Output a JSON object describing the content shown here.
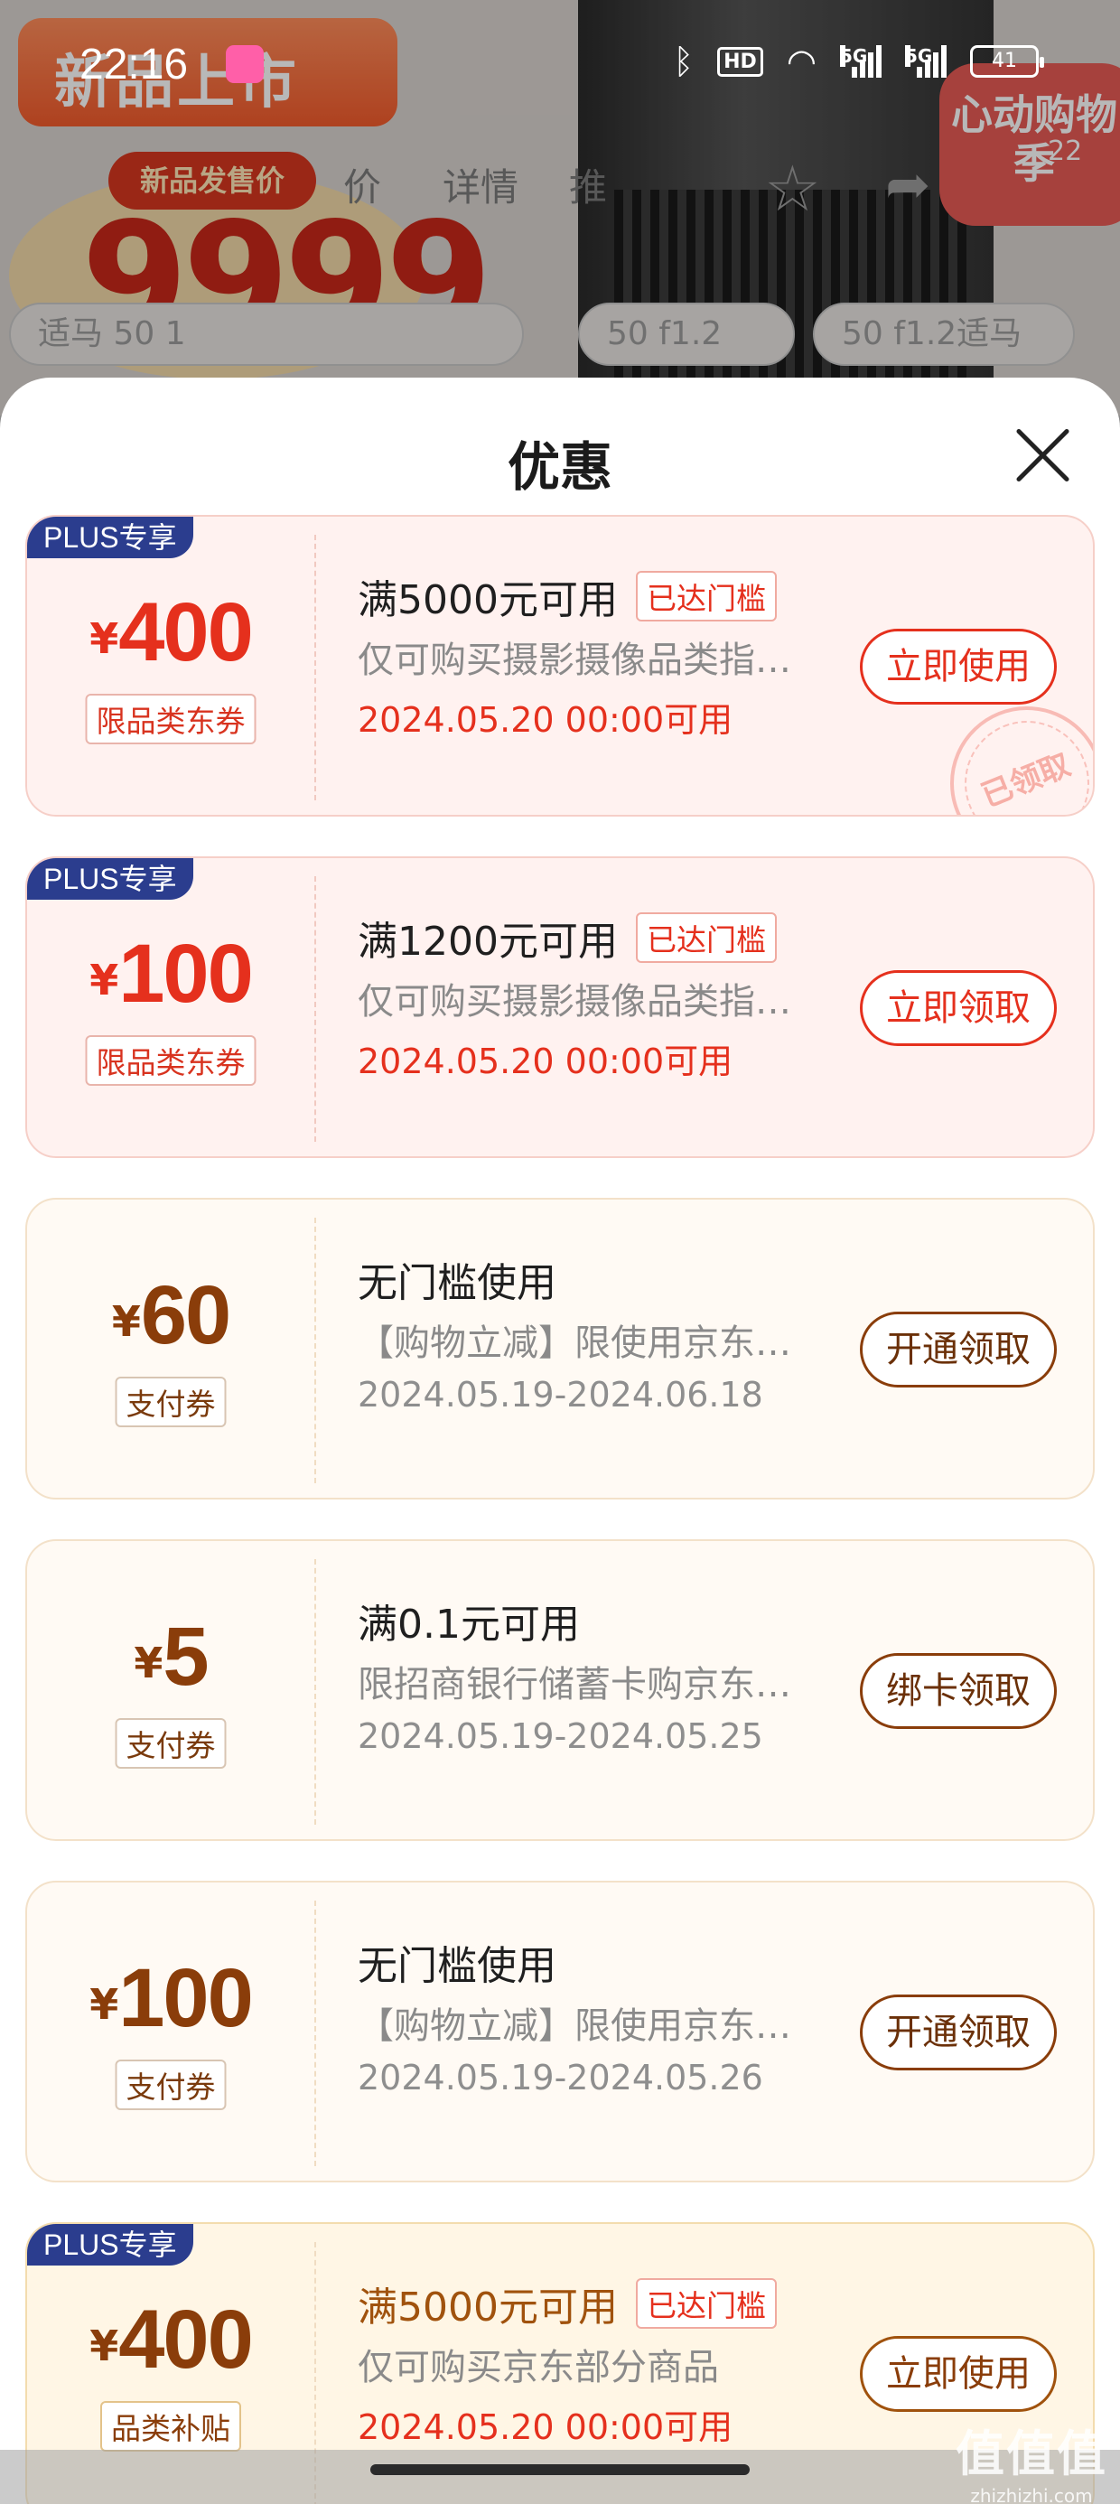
{
  "status_bar": {
    "time": "22:16",
    "hd_label": "HD",
    "network_1": "5G",
    "network_2": "5G",
    "battery": "41"
  },
  "background": {
    "promo_title": "新品上市",
    "launch_price_label": "新品发售价",
    "currency": "¥",
    "price": "9999",
    "tab_detail": "详情",
    "tab_recommend": "推",
    "tab_price": "价",
    "badge_text": "心动购物季",
    "badge_number": "22",
    "chip_1": "适马 50 1",
    "chip_2": "50 f1.2",
    "chip_3": "50 f1.2适马"
  },
  "sheet": {
    "title": "优惠"
  },
  "coupons": [
    {
      "plus_tag": "PLUS专享",
      "currency": "¥",
      "amount": "400",
      "type": "限品类东券",
      "condition": "满5000元可用",
      "reached": "已达门槛",
      "description": "仅可购买摄影摄像品类指定商品",
      "date": "2024.05.20 00:00可用",
      "action": "立即使用",
      "stamp": "已领取"
    },
    {
      "plus_tag": "PLUS专享",
      "currency": "¥",
      "amount": "100",
      "type": "限品类东券",
      "condition": "满1200元可用",
      "reached": "已达门槛",
      "description": "仅可购买摄影摄像品类指定商品",
      "date": "2024.05.20 00:00可用",
      "action": "立即领取"
    },
    {
      "currency": "¥",
      "amount": "60",
      "type": "支付券",
      "condition": "无门槛使用",
      "description": "【购物立减】限使用京东支付",
      "date": "2024.05.19-2024.06.18",
      "action": "开通领取"
    },
    {
      "currency": "¥",
      "amount": "5",
      "type": "支付券",
      "condition": "满0.1元可用",
      "description": "限招商银行储蓄卡购京东商品",
      "date": "2024.05.19-2024.05.25",
      "action": "绑卡领取"
    },
    {
      "currency": "¥",
      "amount": "100",
      "type": "支付券",
      "condition": "无门槛使用",
      "description": "【购物立减】限使用京东支付",
      "date": "2024.05.19-2024.05.26",
      "action": "开通领取"
    },
    {
      "plus_tag": "PLUS专享",
      "currency": "¥",
      "amount": "400",
      "type": "品类补贴",
      "condition": "满5000元可用",
      "reached": "已达门槛",
      "description": "仅可购买京东部分商品",
      "date": "2024.05.20 00:00可用",
      "action": "立即使用"
    }
  ],
  "watermark": {
    "logo": "值值值",
    "url": "zhizhizhi.com"
  },
  "colors": {
    "accent_red": "#e5301d",
    "brown": "#8a3d0a",
    "plus_blue": "#2b3d8e"
  }
}
